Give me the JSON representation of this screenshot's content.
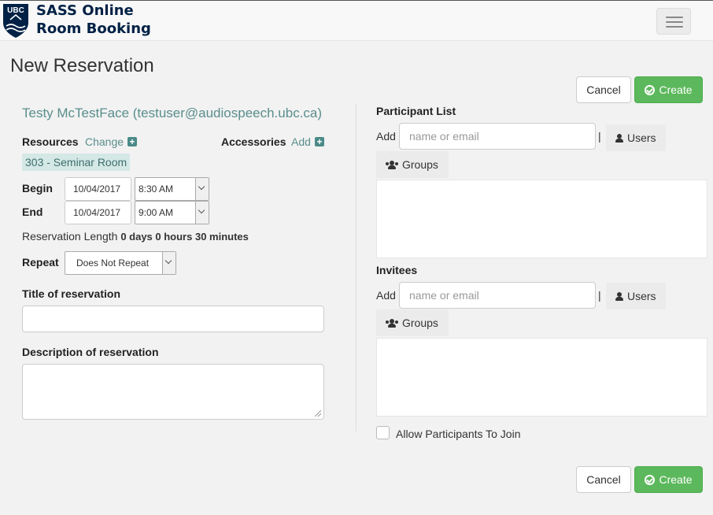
{
  "brand": {
    "line1": "SASS Online",
    "line2": "Room Booking",
    "logo_text": "UBC"
  },
  "page": {
    "title": "New Reservation"
  },
  "actions": {
    "cancel_label": "Cancel",
    "create_label": "Create"
  },
  "owner": {
    "display": "Testy McTestFace (testuser@audiospeech.ubc.ca)"
  },
  "resources": {
    "label": "Resources",
    "change_link": "Change",
    "selected": "303 - Seminar Room"
  },
  "accessories": {
    "label": "Accessories",
    "add_link": "Add"
  },
  "begin": {
    "label": "Begin",
    "date": "10/04/2017",
    "time": "8:30 AM"
  },
  "end": {
    "label": "End",
    "date": "10/04/2017",
    "time": "9:00 AM"
  },
  "length": {
    "label": "Reservation Length",
    "value": "0 days 0 hours 30 minutes"
  },
  "repeat": {
    "label": "Repeat",
    "value": "Does Not Repeat"
  },
  "title_field": {
    "label": "Title of reservation",
    "value": ""
  },
  "description_field": {
    "label": "Description of reservation",
    "value": ""
  },
  "participants": {
    "label": "Participant List",
    "add_label": "Add",
    "placeholder": "name or email",
    "separator": "|",
    "users_label": "Users",
    "groups_label": "Groups"
  },
  "invitees": {
    "label": "Invitees",
    "add_label": "Add",
    "placeholder": "name or email",
    "separator": "|",
    "users_label": "Users",
    "groups_label": "Groups"
  },
  "allow_join": {
    "label": "Allow Participants To Join",
    "checked": false
  },
  "colors": {
    "accent": "#5a8e8c",
    "success": "#5cb85c",
    "brand_navy": "#002145"
  }
}
